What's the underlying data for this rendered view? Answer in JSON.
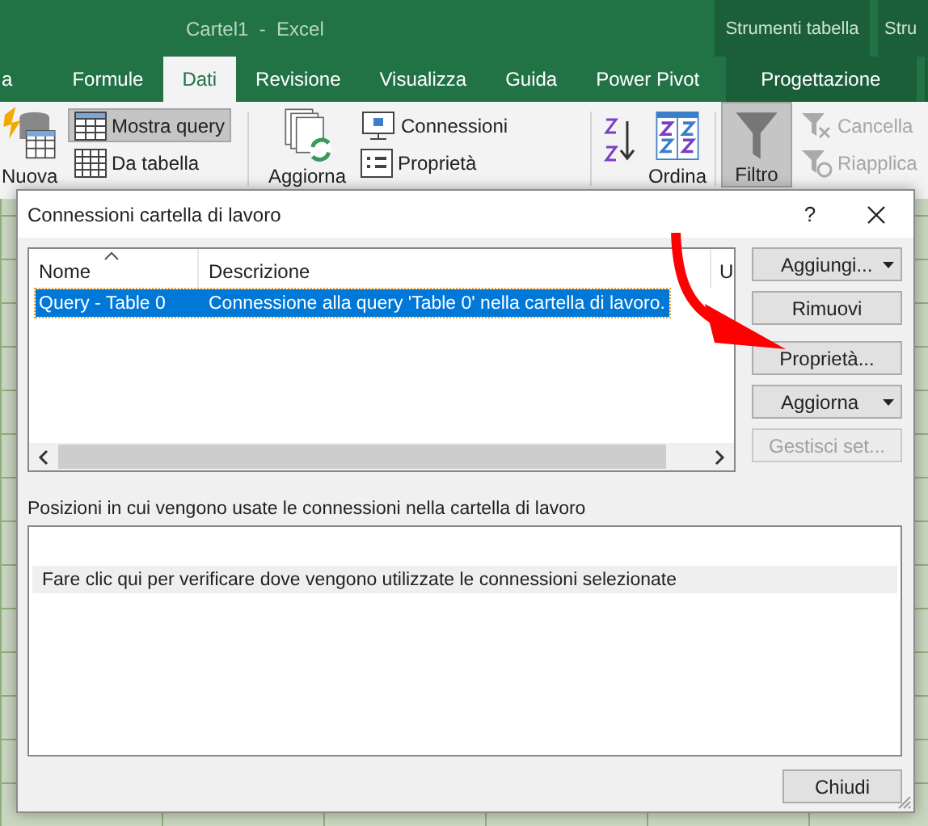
{
  "window": {
    "title": "Cartel1  -  Excel",
    "context_title": "Strumenti tabella",
    "context_title_cut": "Stru"
  },
  "tabs": [
    {
      "label": "a",
      "selected": false,
      "kind": "normal"
    },
    {
      "label": "Formule",
      "selected": false,
      "kind": "normal"
    },
    {
      "label": "Dati",
      "selected": true,
      "kind": "normal"
    },
    {
      "label": "Revisione",
      "selected": false,
      "kind": "normal"
    },
    {
      "label": "Visualizza",
      "selected": false,
      "kind": "normal"
    },
    {
      "label": "Guida",
      "selected": false,
      "kind": "normal"
    },
    {
      "label": "Power Pivot",
      "selected": false,
      "kind": "normal"
    },
    {
      "label": "Progettazione",
      "selected": false,
      "kind": "context"
    }
  ],
  "ribbon": {
    "new_query": {
      "label": "Nuova"
    },
    "show_queries": {
      "label": "Mostra query",
      "pressed": true
    },
    "from_table": {
      "label": "Da tabella",
      "pressed": false
    },
    "refresh": {
      "label": "Aggiorna"
    },
    "connections": {
      "label": "Connessioni"
    },
    "properties": {
      "label": "Proprietà"
    },
    "sort": {
      "label": "Ordina"
    },
    "filter": {
      "label": "Filtro",
      "pressed": true
    },
    "clear": {
      "label": "Cancella",
      "disabled": true
    },
    "reapply": {
      "label": "Riapplica",
      "disabled": true
    }
  },
  "dialog": {
    "title": "Connessioni cartella di lavoro",
    "help": "?",
    "columns": [
      {
        "label": "Nome",
        "sorted": true
      },
      {
        "label": "Descrizione",
        "sorted": false
      },
      {
        "label": "U",
        "sorted": false
      }
    ],
    "rows": [
      {
        "name": "Query - Table 0",
        "description": "Connessione alla query 'Table 0' nella cartella di lavoro.",
        "selected": true
      }
    ],
    "buttons": [
      {
        "label": "Aggiungi...",
        "dropdown": true,
        "disabled": false
      },
      {
        "label": "Rimuovi",
        "dropdown": false,
        "disabled": false
      },
      {
        "label": "Proprietà...",
        "dropdown": false,
        "disabled": false
      },
      {
        "label": "Aggiorna",
        "dropdown": true,
        "disabled": false
      },
      {
        "label": "Gestisci set...",
        "dropdown": false,
        "disabled": true
      }
    ],
    "usage_label": "Posizioni in cui vengono usate le connessioni nella cartella di lavoro",
    "usage_hint": "Fare clic qui per verificare dove vengono utilizzate le connessioni selezionate",
    "close_button": "Chiudi"
  }
}
